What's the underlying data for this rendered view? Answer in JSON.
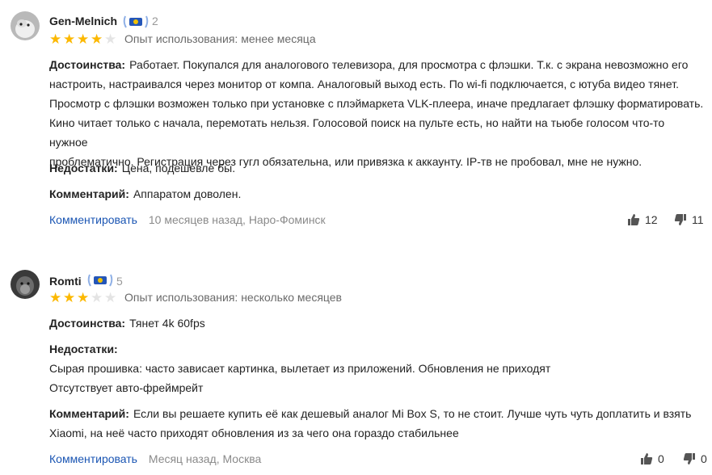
{
  "reviews": [
    {
      "user": "Gen-Melnich",
      "badge_count": "2",
      "rating": 4,
      "experience": "Опыт использования: менее месяца",
      "pros_label": "Достоинства:",
      "pros_lines": [
        "Работает. Покупался для аналогового телевизора, для просмотра с флэшки. Т.к. с экрана невозможно его",
        "настроить, настраивался через монитор от компа. Аналоговый выход есть. По wi-fi подключается, с ютуба видео тянет.",
        "Просмотр с флэшки возможен только при установке с плэймаркета VLK-плеера, иначе предлагает флэшку форматировать.",
        "Кино читает только с начала, перемотать нельзя. Голосовой поиск на пульте есть, но найти на тьюбе голосом что-то нужное",
        "проблематично. Регистрация через гугл обязательна, или привязка к аккаунту. IP-тв не пробовал, мне не нужно."
      ],
      "cons_label": "Недостатки:",
      "cons_text": "Цена, подешевле бы.",
      "comment_label": "Комментарий:",
      "comment_text": "Аппаратом доволен.",
      "action": "Комментировать",
      "meta": "10 месяцев назад, Наро-Фоминск",
      "likes": "12",
      "dislikes": "11"
    },
    {
      "user": "Romti",
      "badge_count": "5",
      "rating": 3,
      "experience": "Опыт использования: несколько месяцев",
      "pros_label": "Достоинства:",
      "pros_text": "Тянет 4k 60fps",
      "cons_label": "Недостатки:",
      "cons_lines": [
        "Сырая прошивка: часто зависает картинка, вылетает из приложений. Обновления не приходят",
        "Отсутствует авто-фреймрейт"
      ],
      "comment_label": "Комментарий:",
      "comment_lines": [
        "Если вы решаете купить её как дешевый аналог Mi Box S, то не стоит. Лучше чуть чуть доплатить и взять",
        "Xiaomi, на неё часто приходят обновления из за чего она гораздо стабильнее"
      ],
      "action": "Комментировать",
      "meta": "Месяц назад, Москва",
      "likes": "0",
      "dislikes": "0"
    }
  ],
  "colors": {
    "star": "#fcb800",
    "star_empty": "#e4e4e4",
    "link": "#1a55b3",
    "badge": "#2456b8"
  }
}
